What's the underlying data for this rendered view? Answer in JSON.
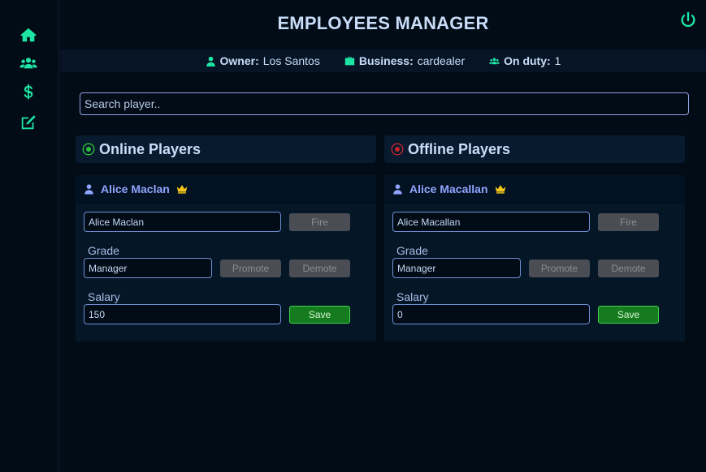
{
  "app": {
    "title": "EMPLOYEES MANAGER",
    "accent": "#1de6a4"
  },
  "sidebar": {
    "items": [
      {
        "name": "home",
        "icon": "home-icon"
      },
      {
        "name": "employees",
        "icon": "users-icon"
      },
      {
        "name": "finance",
        "icon": "dollar-icon"
      },
      {
        "name": "edit",
        "icon": "edit-icon"
      }
    ]
  },
  "header": {
    "power_icon": "power-icon",
    "owner_label": "Owner:",
    "owner_value": "Los Santos",
    "business_label": "Business:",
    "business_value": "cardealer",
    "onduty_label": "On duty:",
    "onduty_value": "1"
  },
  "search": {
    "placeholder": "Search player..",
    "value": ""
  },
  "online": {
    "title": "Online Players",
    "status_color": "#2bbf3a",
    "player": {
      "name": "Alice Maclan",
      "name_field": "Alice Maclan",
      "fire_label": "Fire",
      "grade_label": "Grade",
      "grade_value": "Manager",
      "promote_label": "Promote",
      "demote_label": "Demote",
      "salary_label": "Salary",
      "salary_value": "150",
      "save_label": "Save"
    }
  },
  "offline": {
    "title": "Offline Players",
    "status_color": "#c0262c",
    "player": {
      "name": "Alice Macallan",
      "name_field": "Alice Macallan",
      "fire_label": "Fire",
      "grade_label": "Grade",
      "grade_value": "Manager",
      "promote_label": "Promote",
      "demote_label": "Demote",
      "salary_label": "Salary",
      "salary_value": "0",
      "save_label": "Save"
    }
  }
}
